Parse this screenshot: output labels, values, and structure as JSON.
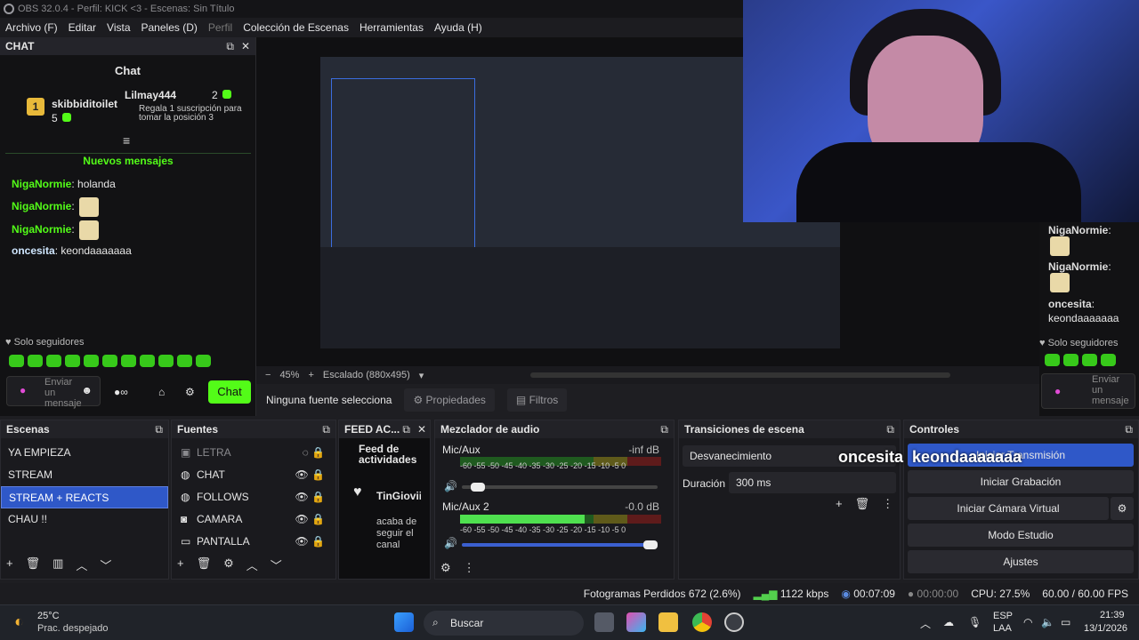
{
  "window": {
    "title": "OBS 32.0.4 - Perfil: KICK <3 - Escenas: Sin Título"
  },
  "menu": [
    "Archivo (F)",
    "Editar",
    "Vista",
    "Paneles (D)",
    "Perfil",
    "Colección de Escenas",
    "Herramientas",
    "Ayuda (H)"
  ],
  "chat": {
    "dock_title": "CHAT",
    "panel_title": "Chat",
    "gifter1": {
      "rank": "1",
      "name": "skibbiditoilet",
      "count": "5"
    },
    "gifter2": {
      "rank": "2",
      "name": "Lilmay444",
      "count": "2",
      "note_rank": "3",
      "note": "Regala 1 suscripción para tomar la posición 3"
    },
    "new_messages": "Nuevos mensajes",
    "messages": [
      {
        "user": "NigaNormie",
        "text": "holanda"
      },
      {
        "user": "NigaNormie",
        "text": ""
      },
      {
        "user": "NigaNormie",
        "text": ""
      },
      {
        "user": "oncesita",
        "text": "keondaaaaaaa"
      }
    ],
    "followers_only": "Solo seguidores",
    "input_placeholder": "Enviar un mensaje",
    "send_label": "Chat"
  },
  "right_chat": {
    "messages": [
      {
        "user": "NigaNormie",
        "text": ""
      },
      {
        "user": "NigaNormie",
        "text": ""
      },
      {
        "user": "oncesita",
        "text": "keondaaaaaaa"
      }
    ],
    "followers_only": "Solo seguidores",
    "input_placeholder": "Enviar un mensaje"
  },
  "preview": {
    "zoom": "45%",
    "scaling": "Escalado (880x495)"
  },
  "source_bar": {
    "none_selected": "Ninguna fuente selecciona",
    "properties": "Propiedades",
    "filters": "Filtros"
  },
  "scenes": {
    "title": "Escenas",
    "items": [
      "YA EMPIEZA",
      "STREAM",
      "STREAM + REACTS",
      "CHAU !!"
    ],
    "selected": "STREAM + REACTS"
  },
  "sources": {
    "title": "Fuentes",
    "items": [
      "LETRA",
      "CHAT",
      "FOLLOWS",
      "CAMARA",
      "PANTALLA"
    ]
  },
  "feed": {
    "dock_title": "FEED AC...",
    "title": "Feed de actividades",
    "user": "TinGiovii",
    "text": "acaba de seguir el canal"
  },
  "mixer": {
    "title": "Mezclador de audio",
    "channels": [
      {
        "name": "Mic/Aux",
        "db": "-inf dB",
        "level": 0,
        "volume": 0.05
      },
      {
        "name": "Mic/Aux 2",
        "db": "-0.0 dB",
        "level": 0.62,
        "volume": 1.0
      }
    ],
    "scale": "-60  -55  -50  -45  -40  -35  -30  -25  -20  -15  -10  -5  0"
  },
  "transitions": {
    "title": "Transiciones de escena",
    "selected": "Desvanecimiento",
    "duration_label": "Duración",
    "duration_value": "300 ms"
  },
  "overlay_text": {
    "user": "oncesita",
    "text": "keondaaaaaaa"
  },
  "controls": {
    "title": "Controles",
    "buttons": [
      "Iniciar Transmisión",
      "Iniciar Grabación",
      "Iniciar Cámara Virtual",
      "Modo Estudio",
      "Ajustes"
    ]
  },
  "status": {
    "dropped": "Fotogramas Perdidos 672 (2.6%)",
    "bitrate": "1122 kbps",
    "stream_time": "00:07:09",
    "rec_time": "00:00:00",
    "cpu": "CPU: 27.5%",
    "fps": "60.00 / 60.00 FPS"
  },
  "taskbar": {
    "temp": "25°C",
    "weather": "Prac. despejado",
    "search": "Buscar",
    "lang1": "ESP",
    "lang2": "LAA",
    "time": "21:39",
    "date": "13/1/2026"
  },
  "colors": {
    "accent": "#53fc18",
    "selection": "#2f58c8"
  }
}
